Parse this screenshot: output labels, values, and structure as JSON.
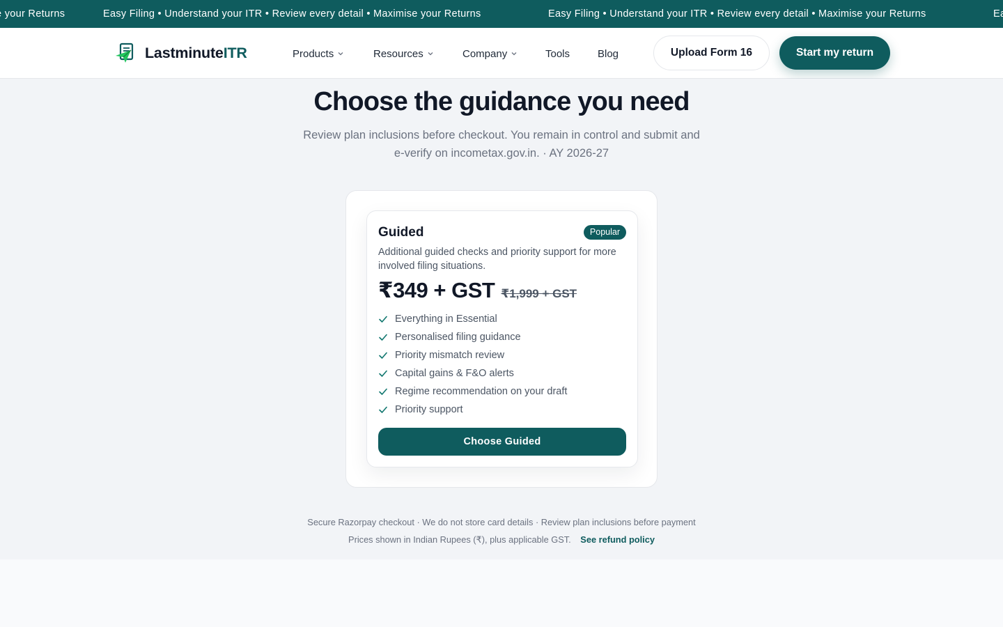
{
  "ticker": {
    "items": [
      "e your Returns",
      "Easy Filing • Understand your ITR • Review every detail • Maximise your Returns",
      "Easy Filing • Understand your ITR • Review every detail • Maximise your Returns",
      "Ea"
    ]
  },
  "header": {
    "logo_text": "Lastminute",
    "logo_accent": "ITR",
    "nav": {
      "products": "Products",
      "resources": "Resources",
      "company": "Company",
      "tools": "Tools",
      "blog": "Blog"
    },
    "upload_label": "Upload Form 16",
    "start_label": "Start my return"
  },
  "main": {
    "title": "Choose the guidance you need",
    "subtitle_line1": "Review plan inclusions before checkout. You remain in control and submit and",
    "subtitle_line2": "e-verify on incometax.gov.in. · AY 2026-27"
  },
  "plan": {
    "name": "Guided",
    "badge": "Popular",
    "description": "Additional guided checks and priority support for more involved filing situations.",
    "price": "₹349 + GST",
    "old_price": "₹1,999 + GST",
    "features": [
      "Everything in Essential",
      "Personalised filing guidance",
      "Priority mismatch review",
      "Capital gains & F&O alerts",
      "Regime recommendation on your draft",
      "Priority support"
    ],
    "cta": "Choose Guided"
  },
  "footer": {
    "line1": "Secure Razorpay checkout · We do not store card details · Review plan inclusions before payment",
    "line2": "Prices shown in Indian Rupees (₹), plus applicable GST.",
    "refund_link": "See refund policy"
  },
  "colors": {
    "brand": "#0f5c5e",
    "check": "#0f766e",
    "logo_green": "#22c55e"
  },
  "icons": {
    "logo": "document-paper-plane-icon",
    "nav_dropdown": "chevron-down-icon",
    "feature": "check-icon"
  }
}
